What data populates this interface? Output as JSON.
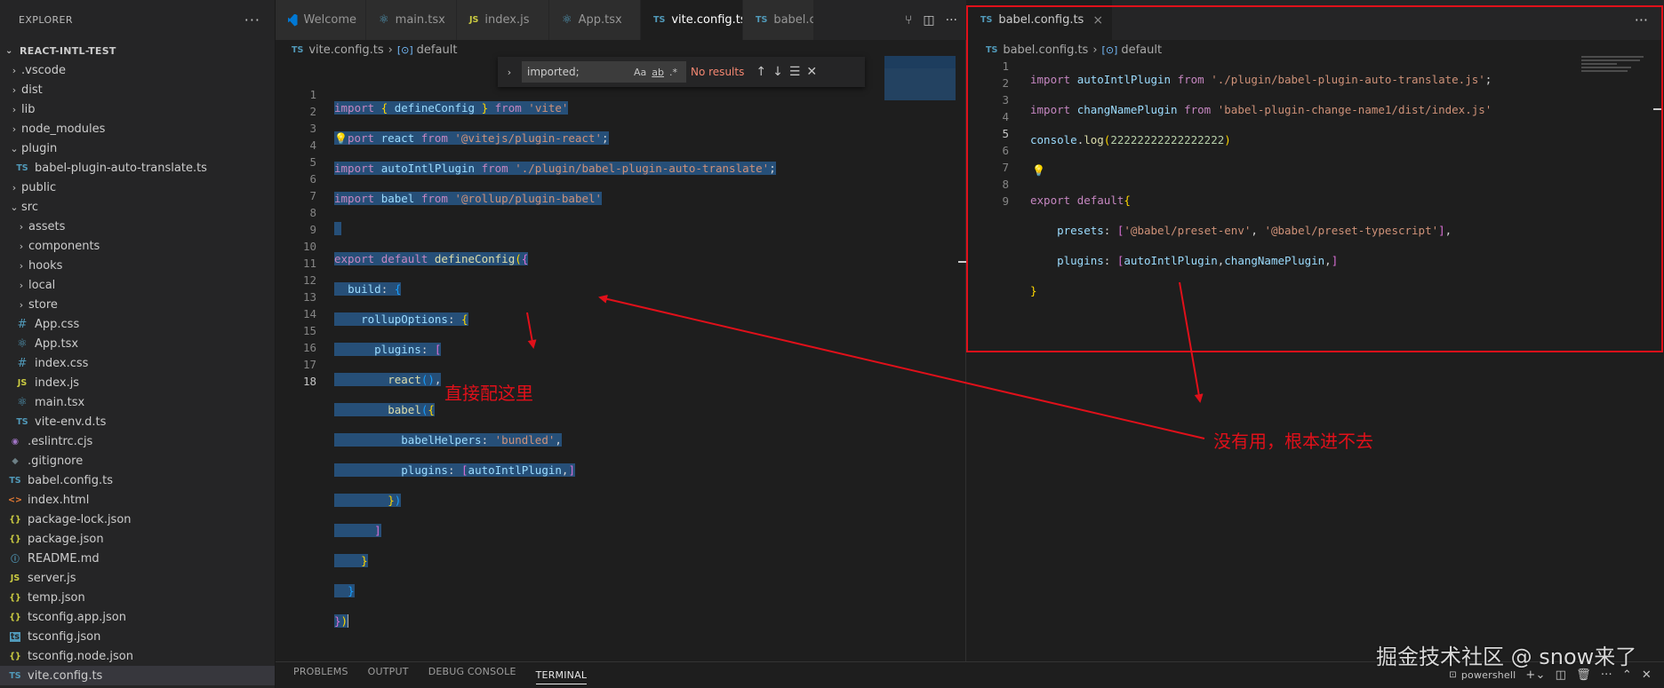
{
  "explorer": {
    "title": "EXPLORER",
    "more": "···",
    "project": "REACT-INTL-TEST",
    "tree": [
      {
        "label": ".vscode",
        "chev": "›",
        "icon": "",
        "icon_name": "folder-icon",
        "depth": 0
      },
      {
        "label": "dist",
        "chev": "›",
        "icon": "",
        "icon_name": "folder-icon",
        "depth": 0
      },
      {
        "label": "lib",
        "chev": "›",
        "icon": "",
        "icon_name": "folder-icon",
        "depth": 0
      },
      {
        "label": "node_modules",
        "chev": "›",
        "icon": "",
        "icon_name": "folder-icon",
        "depth": 0
      },
      {
        "label": "plugin",
        "chev": "⌄",
        "icon": "",
        "icon_name": "folder-open-icon",
        "depth": 0
      },
      {
        "label": "babel-plugin-auto-translate.ts",
        "chev": "",
        "icon": "TS",
        "icon_name": "typescript-file-icon",
        "depth": 1
      },
      {
        "label": "public",
        "chev": "›",
        "icon": "",
        "icon_name": "folder-icon",
        "depth": 0
      },
      {
        "label": "src",
        "chev": "⌄",
        "icon": "",
        "icon_name": "folder-open-icon",
        "depth": 0
      },
      {
        "label": "assets",
        "chev": "›",
        "icon": "",
        "icon_name": "folder-icon",
        "depth": 1
      },
      {
        "label": "components",
        "chev": "›",
        "icon": "",
        "icon_name": "folder-icon",
        "depth": 1
      },
      {
        "label": "hooks",
        "chev": "›",
        "icon": "",
        "icon_name": "folder-icon",
        "depth": 1
      },
      {
        "label": "local",
        "chev": "›",
        "icon": "",
        "icon_name": "folder-icon",
        "depth": 1
      },
      {
        "label": "store",
        "chev": "›",
        "icon": "",
        "icon_name": "folder-icon",
        "depth": 1
      },
      {
        "label": "App.css",
        "chev": "",
        "icon": "#",
        "icon_name": "css-file-icon",
        "depth": 1
      },
      {
        "label": "App.tsx",
        "chev": "",
        "icon": "⚛",
        "icon_name": "react-file-icon",
        "depth": 1
      },
      {
        "label": "index.css",
        "chev": "",
        "icon": "#",
        "icon_name": "css-file-icon",
        "depth": 1
      },
      {
        "label": "index.js",
        "chev": "",
        "icon": "JS",
        "icon_name": "javascript-file-icon",
        "depth": 1
      },
      {
        "label": "main.tsx",
        "chev": "",
        "icon": "⚛",
        "icon_name": "react-file-icon",
        "depth": 1
      },
      {
        "label": "vite-env.d.ts",
        "chev": "",
        "icon": "TS",
        "icon_name": "typescript-file-icon",
        "depth": 1
      },
      {
        "label": ".eslintrc.cjs",
        "chev": "",
        "icon": "◉",
        "icon_name": "eslint-file-icon",
        "depth": 0
      },
      {
        "label": ".gitignore",
        "chev": "",
        "icon": "◆",
        "icon_name": "git-file-icon",
        "depth": 0
      },
      {
        "label": "babel.config.ts",
        "chev": "",
        "icon": "TS",
        "icon_name": "typescript-file-icon",
        "depth": 0
      },
      {
        "label": "index.html",
        "chev": "",
        "icon": "<>",
        "icon_name": "html-file-icon",
        "depth": 0
      },
      {
        "label": "package-lock.json",
        "chev": "",
        "icon": "{}",
        "icon_name": "json-file-icon",
        "depth": 0
      },
      {
        "label": "package.json",
        "chev": "",
        "icon": "{}",
        "icon_name": "json-file-icon",
        "depth": 0
      },
      {
        "label": "README.md",
        "chev": "",
        "icon": "ⓘ",
        "icon_name": "info-file-icon",
        "depth": 0
      },
      {
        "label": "server.js",
        "chev": "",
        "icon": "JS",
        "icon_name": "javascript-file-icon",
        "depth": 0
      },
      {
        "label": "temp.json",
        "chev": "",
        "icon": "{}",
        "icon_name": "json-file-icon",
        "depth": 0
      },
      {
        "label": "tsconfig.app.json",
        "chev": "",
        "icon": "{}",
        "icon_name": "json-file-icon",
        "depth": 0
      },
      {
        "label": "tsconfig.json",
        "chev": "",
        "icon": "ts",
        "icon_name": "tsconfig-file-icon",
        "depth": 0
      },
      {
        "label": "tsconfig.node.json",
        "chev": "",
        "icon": "{}",
        "icon_name": "json-file-icon",
        "depth": 0
      },
      {
        "label": "vite.config.ts",
        "chev": "",
        "icon": "TS",
        "icon_name": "typescript-file-icon",
        "depth": 0,
        "selected": true
      }
    ]
  },
  "group1": {
    "tabs": [
      {
        "label": "Welcome",
        "icon": "",
        "icon_name": "vscode-icon",
        "active": false
      },
      {
        "label": "main.tsx",
        "icon": "⚛",
        "icon_name": "react-file-icon",
        "active": false
      },
      {
        "label": "index.js",
        "icon": "JS",
        "icon_name": "javascript-file-icon",
        "active": false
      },
      {
        "label": "App.tsx",
        "icon": "⚛",
        "icon_name": "react-file-icon",
        "active": false
      },
      {
        "label": "vite.config.ts",
        "icon": "TS",
        "icon_name": "typescript-file-icon",
        "active": true,
        "close": "×"
      },
      {
        "label": "babel.conf",
        "icon": "TS",
        "icon_name": "typescript-file-icon",
        "active": false
      }
    ],
    "breadcrumb": {
      "file": "vite.config.ts",
      "symbol": "default"
    },
    "find": {
      "value": "imported;",
      "match_case": "Aa",
      "whole_word": "ab",
      "regex": ".*",
      "status": "No results"
    },
    "line_numbers": [
      "1",
      "2",
      "3",
      "4",
      "5",
      "6",
      "7",
      "8",
      "9",
      "10",
      "11",
      "12",
      "13",
      "14",
      "15",
      "16",
      "17",
      "18"
    ]
  },
  "group2": {
    "tab": {
      "label": "babel.config.ts",
      "icon": "TS",
      "close": "×"
    },
    "more": "···",
    "breadcrumb": {
      "file": "babel.config.ts",
      "symbol": "default"
    },
    "line_numbers": [
      "1",
      "2",
      "3",
      "4",
      "5",
      "6",
      "7",
      "8",
      "9"
    ]
  },
  "annotations": {
    "configure_here": "直接配这里",
    "no_use": "没有用，根本进不去",
    "color": "#e0101a"
  },
  "panel": {
    "tabs": [
      "PROBLEMS",
      "OUTPUT",
      "DEBUG CONSOLE",
      "TERMINAL"
    ],
    "active_tab": "TERMINAL",
    "terminal_name": "powershell"
  },
  "watermark": "掘金技术社区 @ snow来了",
  "colors": {
    "selection": "#264f78",
    "keyword": "#c586c0",
    "string": "#ce9178",
    "function": "#dcdcaa",
    "variable": "#9cdcfe"
  }
}
